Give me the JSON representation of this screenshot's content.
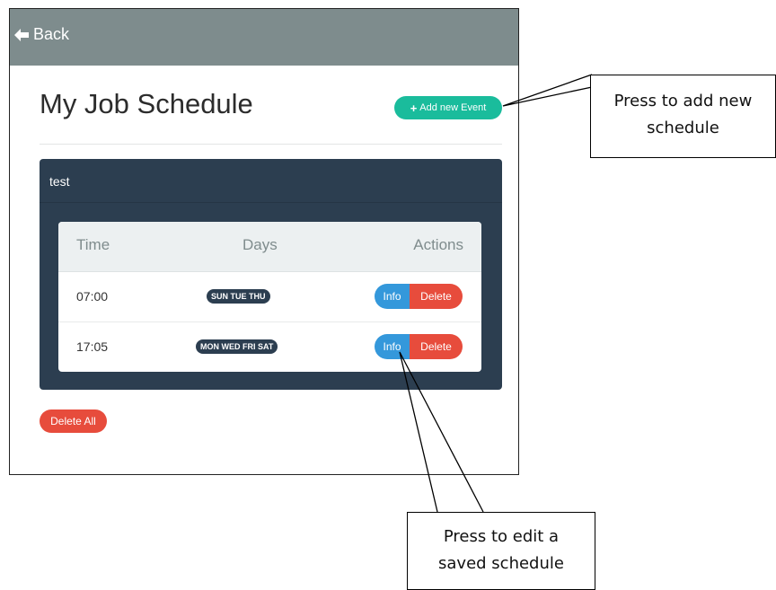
{
  "header": {
    "back_label": "Back"
  },
  "page": {
    "title": "My Job Schedule",
    "add_event_label": "Add new Event",
    "delete_all_label": "Delete All"
  },
  "schedule": {
    "name": "test",
    "columns": [
      "Time",
      "Days",
      "Actions"
    ],
    "rows": [
      {
        "time": "07:00",
        "days": "SUN TUE THU",
        "info_label": "Info",
        "delete_label": "Delete"
      },
      {
        "time": "17:05",
        "days": "MON WED FRI SAT",
        "info_label": "Info",
        "delete_label": "Delete"
      }
    ]
  },
  "annotations": {
    "add_note_line1": "Press to add new",
    "add_note_line2": "schedule",
    "edit_note_line1": "Press to edit a",
    "edit_note_line2": "saved schedule"
  },
  "colors": {
    "topbar": "#7e8c8d",
    "accent_green": "#1abc9c",
    "panel": "#2c3e50",
    "info_blue": "#3498db",
    "delete_red": "#e74c3c"
  }
}
